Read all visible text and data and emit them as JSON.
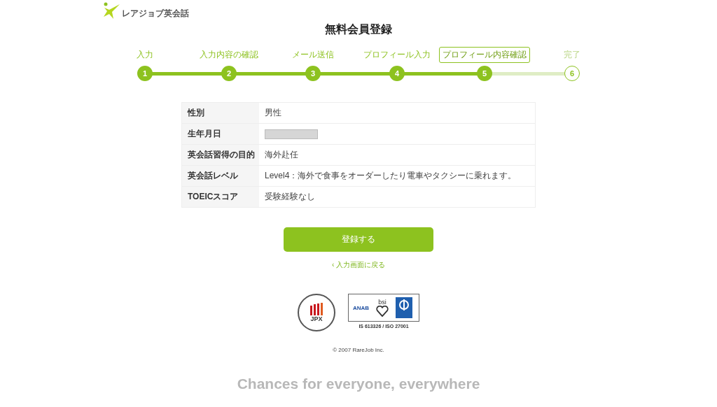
{
  "logo": {
    "text": "レアジョブ英会話"
  },
  "title": "無料会員登録",
  "steps": [
    {
      "label": "入力",
      "number": "1",
      "done": true,
      "current": false
    },
    {
      "label": "入力内容の確認",
      "number": "2",
      "done": true,
      "current": false
    },
    {
      "label": "メール送信",
      "number": "3",
      "done": true,
      "current": false
    },
    {
      "label": "プロフィール入力",
      "number": "4",
      "done": true,
      "current": false
    },
    {
      "label": "プロフィール内容確認",
      "number": "5",
      "done": true,
      "current": true
    },
    {
      "label": "完了",
      "number": "6",
      "done": false,
      "current": false
    }
  ],
  "table": {
    "rows": [
      {
        "label": "性別",
        "kind": "text",
        "value": "男性"
      },
      {
        "label": "生年月日",
        "kind": "masked"
      },
      {
        "label": "英会話習得の目的",
        "kind": "text",
        "value": "海外赴任"
      },
      {
        "label": "英会話レベル",
        "kind": "text",
        "value": "Level4：海外で食事をオーダーしたり電車やタクシーに乗れます。"
      },
      {
        "label": "TOEICスコア",
        "kind": "text",
        "value": "受験経験なし"
      }
    ]
  },
  "submit_button": "登録する",
  "back_link": {
    "arrow": "‹",
    "text": "入力画面に戻る"
  },
  "badges": {
    "jpx": "JPX",
    "anab": "ANAB",
    "bsi": "bsi",
    "iso": "IS 613326 / ISO 27001"
  },
  "copyright": "© 2007 RareJob Inc.",
  "tagline": "Chances for everyone, everywhere"
}
